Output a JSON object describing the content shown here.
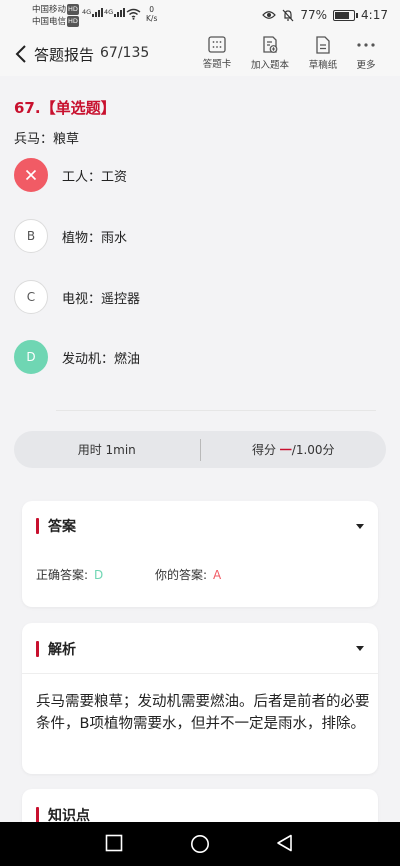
{
  "status": {
    "carrier1": "中国移动",
    "carrier2": "中国电信",
    "hd_badge": "HD",
    "network1": "4G",
    "network2": "4G",
    "speed_value": "0",
    "speed_unit": "K/s",
    "battery": "77%",
    "time": "4:17"
  },
  "header": {
    "title": "答题报告",
    "progress": "67/135",
    "tools": [
      {
        "label": "答题卡",
        "icon": "answer-sheet-icon"
      },
      {
        "label": "加入题本",
        "icon": "add-notebook-icon"
      },
      {
        "label": "草稿纸",
        "icon": "draft-paper-icon"
      },
      {
        "label": "更多",
        "icon": "more-icon"
      }
    ]
  },
  "question": {
    "number": "67.【单选题】",
    "stem": "兵马：粮草",
    "options": [
      {
        "letter": "A",
        "text": "工人：工资",
        "state": "wrong"
      },
      {
        "letter": "B",
        "text": "植物：雨水",
        "state": "normal"
      },
      {
        "letter": "C",
        "text": "电视：遥控器",
        "state": "normal"
      },
      {
        "letter": "D",
        "text": "发动机：燃油",
        "state": "correct"
      }
    ]
  },
  "stats": {
    "time_label": "用时 1min",
    "score_label": "得分",
    "score_value": "一",
    "score_total": "/1.00分"
  },
  "answer_card": {
    "title": "答案",
    "correct_label": "正确答案:",
    "correct_value": "D",
    "yours_label": "你的答案:",
    "yours_value": "A"
  },
  "analysis_card": {
    "title": "解析",
    "text": "兵马需要粮草；发动机需要燃油。后者是前者的必要条件，B项植物需要水，但并不一定是雨水，排除。"
  },
  "knowledge_card": {
    "title": "知识点"
  },
  "colors": {
    "accent_red": "#c8102e",
    "wrong": "#f15b65",
    "correct": "#6fd6b3"
  }
}
